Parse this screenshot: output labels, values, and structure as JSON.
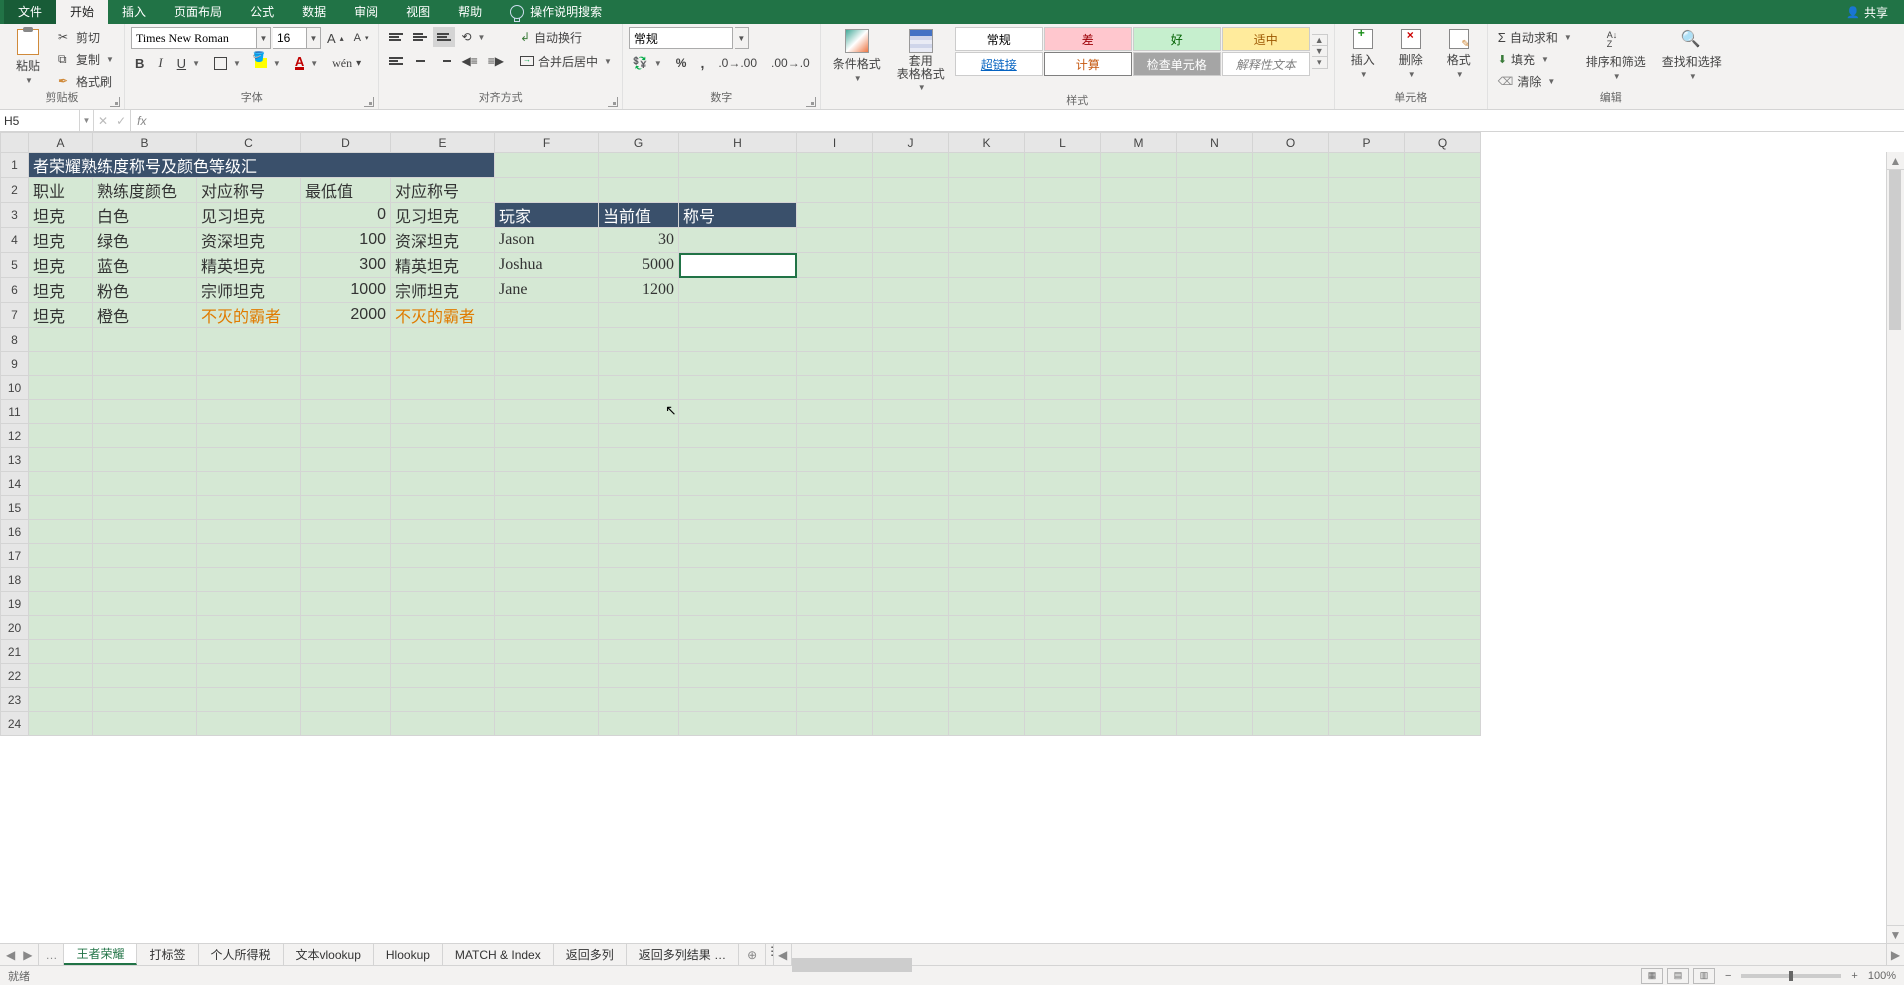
{
  "ribbon": {
    "tabs": {
      "file": "文件",
      "home": "开始",
      "insert": "插入",
      "layout": "页面布局",
      "formula": "公式",
      "data": "数据",
      "review": "审阅",
      "view": "视图",
      "help": "帮助",
      "tellme": "操作说明搜索"
    },
    "share": "共享",
    "clipboard": {
      "paste": "粘贴",
      "cut": "剪切",
      "copy": "复制",
      "painter": "格式刷",
      "label": "剪贴板"
    },
    "font": {
      "name": "Times New Roman",
      "size": "16",
      "bold": "B",
      "italic": "I",
      "underline": "U",
      "label": "字体"
    },
    "align": {
      "wrap": "自动换行",
      "merge": "合并后居中",
      "label": "对齐方式"
    },
    "number": {
      "format": "常规",
      "label": "数字"
    },
    "styles": {
      "condfmt": "条件格式",
      "table": "套用\n表格格式",
      "normal": "常规",
      "bad": "差",
      "good": "好",
      "neutral": "适中",
      "link": "超链接",
      "calc": "计算",
      "check": "检查单元格",
      "explain": "解释性文本",
      "label": "样式"
    },
    "cells": {
      "insert": "插入",
      "delete": "删除",
      "format": "格式",
      "label": "单元格"
    },
    "editing": {
      "sum": "自动求和",
      "fill": "填充",
      "clear": "清除",
      "sort": "排序和筛选",
      "find": "查找和选择",
      "label": "编辑"
    }
  },
  "namebox": "H5",
  "formula": "",
  "columns": [
    "A",
    "B",
    "C",
    "D",
    "E",
    "F",
    "G",
    "H",
    "I",
    "J",
    "K",
    "L",
    "M",
    "N",
    "O",
    "P",
    "Q"
  ],
  "rows": 24,
  "title": "者荣耀熟练度称号及颜色等级汇",
  "headers1": {
    "A": "职业",
    "B": "熟练度颜色",
    "C": "对应称号",
    "D": "最低值",
    "E": "对应称号"
  },
  "headers2": {
    "F": "玩家",
    "G": "当前值",
    "H": "称号"
  },
  "table1": [
    {
      "A": "坦克",
      "B": "白色",
      "C": "见习坦克",
      "D": "0",
      "E": "见习坦克",
      "orange": false
    },
    {
      "A": "坦克",
      "B": "绿色",
      "C": "资深坦克",
      "D": "100",
      "E": "资深坦克",
      "orange": false
    },
    {
      "A": "坦克",
      "B": "蓝色",
      "C": "精英坦克",
      "D": "300",
      "E": "精英坦克",
      "orange": false
    },
    {
      "A": "坦克",
      "B": "粉色",
      "C": "宗师坦克",
      "D": "1000",
      "E": "宗师坦克",
      "orange": false
    },
    {
      "A": "坦克",
      "B": "橙色",
      "C": "不灭的霸者",
      "D": "2000",
      "E": "不灭的霸者",
      "orange": true
    }
  ],
  "table2": [
    {
      "F": "Jason",
      "G": "30"
    },
    {
      "F": "Joshua",
      "G": "5000"
    },
    {
      "F": "Jane",
      "G": "1200"
    }
  ],
  "selected": {
    "row": 5,
    "col": "H"
  },
  "sheets": [
    "王者荣耀",
    "打标签",
    "个人所得税",
    "文本vlookup",
    "Hlookup",
    "MATCH & Index",
    "返回多列",
    "返回多列结果 …"
  ],
  "activeSheet": 0,
  "status": "就绪",
  "zoom": "100%"
}
